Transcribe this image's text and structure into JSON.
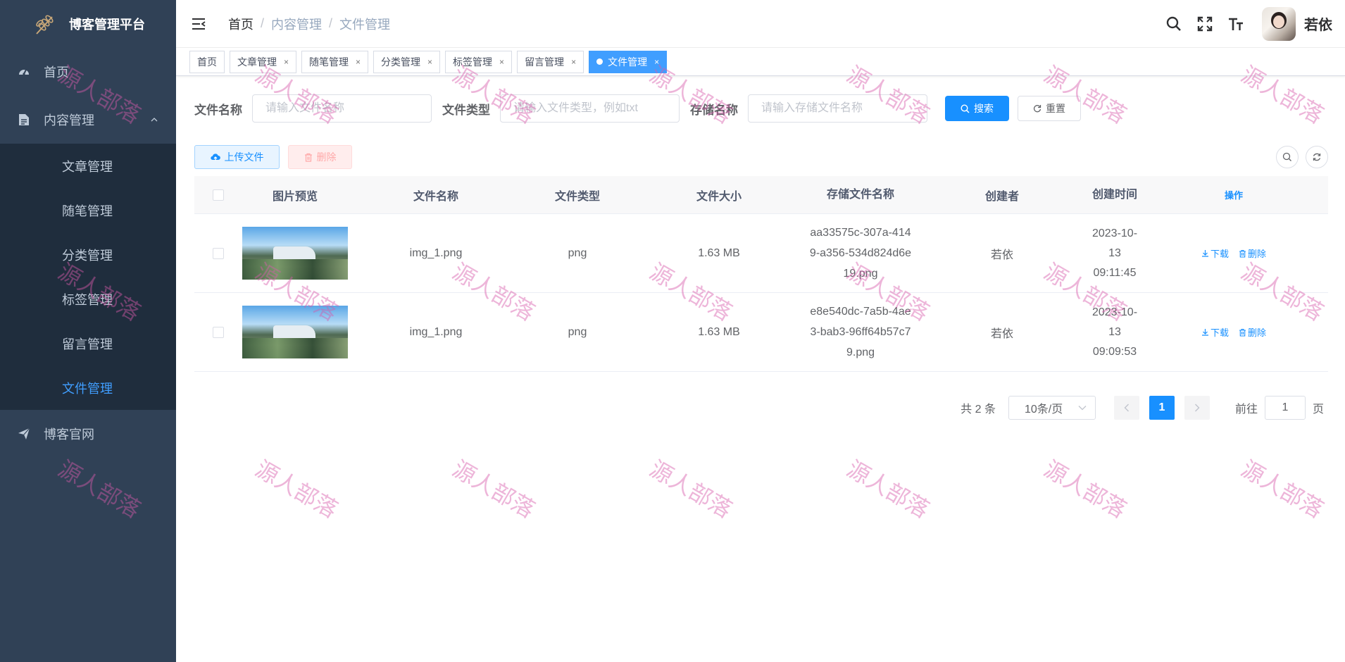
{
  "sidebar": {
    "title": "博客管理平台",
    "items": [
      {
        "label": "首页",
        "icon": "dashboard-icon"
      },
      {
        "label": "内容管理",
        "icon": "document-icon",
        "expanded": true
      },
      {
        "label": "博客官网",
        "icon": "send-icon"
      }
    ],
    "submenu": [
      {
        "label": "文章管理"
      },
      {
        "label": "随笔管理"
      },
      {
        "label": "分类管理"
      },
      {
        "label": "标签管理"
      },
      {
        "label": "留言管理"
      },
      {
        "label": "文件管理",
        "active": true
      }
    ]
  },
  "navbar": {
    "breadcrumb": [
      "首页",
      "内容管理",
      "文件管理"
    ],
    "breadcrumb_sep": "/",
    "username": "若依"
  },
  "tags": [
    {
      "label": "首页",
      "closable": false
    },
    {
      "label": "文章管理",
      "closable": true
    },
    {
      "label": "随笔管理",
      "closable": true
    },
    {
      "label": "分类管理",
      "closable": true
    },
    {
      "label": "标签管理",
      "closable": true
    },
    {
      "label": "留言管理",
      "closable": true
    },
    {
      "label": "文件管理",
      "closable": true,
      "active": true
    }
  ],
  "tag_close": "×",
  "search": {
    "name_label": "文件名称",
    "name_placeholder": "请输入文件名称",
    "type_label": "文件类型",
    "type_placeholder": "请输入文件类型，例如txt",
    "store_label": "存储名称",
    "store_placeholder": "请输入存储文件名称",
    "search_btn": "搜索",
    "reset_btn": "重置"
  },
  "toolbar": {
    "upload_btn": "上传文件",
    "delete_btn": "删除"
  },
  "table": {
    "headers": [
      "图片预览",
      "文件名称",
      "文件类型",
      "文件大小",
      "存储文件名称",
      "创建者",
      "创建时间",
      "操作"
    ],
    "rows": [
      {
        "name": "img_1.png",
        "type": "png",
        "size": "1.63 MB",
        "store": "aa33575c-307a-4149-a356-534d824d6e19.png",
        "creator": "若依",
        "time": "2023-10-13 09:11:45"
      },
      {
        "name": "img_1.png",
        "type": "png",
        "size": "1.63 MB",
        "store": "e8e540dc-7a5b-4ae3-bab3-96ff64b57c79.png",
        "creator": "若依",
        "time": "2023-10-13 09:09:53"
      }
    ],
    "op_download": "下载",
    "op_delete": "删除"
  },
  "pagination": {
    "total": "共 2 条",
    "page_size": "10条/页",
    "current": "1",
    "goto_label": "前往",
    "goto_value": "1",
    "page_unit": "页"
  },
  "watermark": "源人部落",
  "colors": {
    "sidebar_bg": "#304156",
    "submenu_bg": "#1f2d3d",
    "primary": "#1890ff",
    "active_menu": "#409eff"
  }
}
